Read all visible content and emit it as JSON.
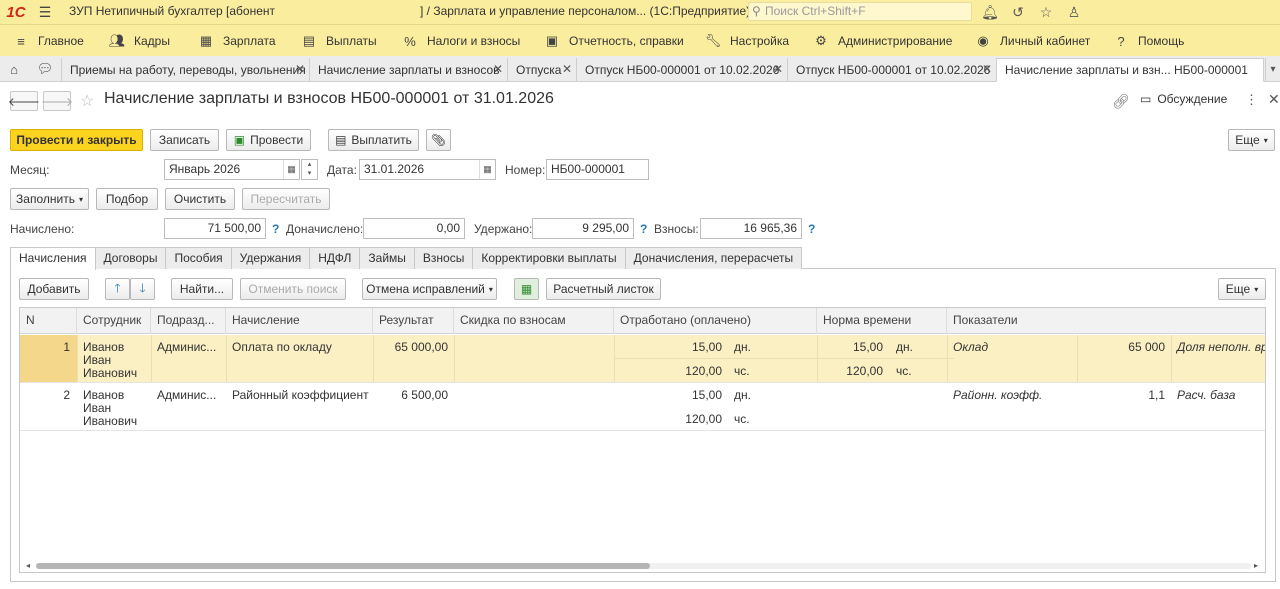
{
  "app": {
    "logo": "1С",
    "title": "ЗУП Нетипичный бухгалтер [абонент",
    "title_suffix": "] / Зарплата и управление персоналом...  (1С:Предприятие)",
    "search_placeholder": "Поиск Ctrl+Shift+F"
  },
  "main_menu": [
    {
      "label": "Главное",
      "icon": "menu-lines-icon"
    },
    {
      "label": "Кадры",
      "icon": "people-icon"
    },
    {
      "label": "Зарплата",
      "icon": "calculator-icon"
    },
    {
      "label": "Выплаты",
      "icon": "wallet-icon"
    },
    {
      "label": "Налоги и взносы",
      "icon": "percent-icon"
    },
    {
      "label": "Отчетность, справки",
      "icon": "report-icon"
    },
    {
      "label": "Настройка",
      "icon": "wrench-icon"
    },
    {
      "label": "Администрирование",
      "icon": "gear-icon"
    },
    {
      "label": "Личный кабинет",
      "icon": "user-icon"
    },
    {
      "label": "Помощь",
      "icon": "question-icon"
    }
  ],
  "open_tabs": [
    {
      "label": "Приемы на работу, переводы, увольнения"
    },
    {
      "label": "Начисление зарплаты и взносов"
    },
    {
      "label": "Отпуска"
    },
    {
      "label": "Отпуск НБ00-000001 от 10.02.2026"
    },
    {
      "label": "Отпуск НБ00-000001 от 10.02.2026"
    },
    {
      "label": "Начисление зарплаты и взн...    НБ00-000001"
    }
  ],
  "document": {
    "title": "Начисление зарплаты и взносов НБ00-000001 от 31.01.2026",
    "discuss_label": "Обсуждение"
  },
  "toolbar": {
    "post_close": "Провести и закрыть",
    "save": "Записать",
    "post": "Провести",
    "pay": "Выплатить",
    "more": "Еще"
  },
  "fields": {
    "month_label": "Месяц:",
    "month_value": "Январь 2026",
    "date_label": "Дата:",
    "date_value": "31.01.2026",
    "number_label": "Номер:",
    "number_value": "НБ00-000001"
  },
  "actions": {
    "fill": "Заполнить",
    "select": "Подбор",
    "clear": "Очистить",
    "recalc": "Пересчитать"
  },
  "totals": {
    "accrued_label": "Начислено:",
    "accrued_value": "71 500,00",
    "extra_label": "Доначислено:",
    "extra_value": "0,00",
    "withheld_label": "Удержано:",
    "withheld_value": "9 295,00",
    "contrib_label": "Взносы:",
    "contrib_value": "16 965,36",
    "help": "?"
  },
  "inner_tabs": [
    "Начисления",
    "Договоры",
    "Пособия",
    "Удержания",
    "НДФЛ",
    "Займы",
    "Взносы",
    "Корректировки выплаты",
    "Доначисления, перерасчеты"
  ],
  "table_toolbar": {
    "add": "Добавить",
    "find": "Найти...",
    "cancel_search": "Отменить поиск",
    "cancel_fix": "Отмена исправлений",
    "payslip": "Расчетный листок",
    "more": "Еще"
  },
  "table": {
    "columns": [
      "N",
      "Сотрудник",
      "Подразд...",
      "Начисление",
      "Результат",
      "Скидка по взносам",
      "Отработано (оплачено)",
      "Норма времени",
      "Показатели"
    ],
    "rows": [
      {
        "n": "1",
        "employee": [
          "Иванов",
          "Иван",
          "Иванович"
        ],
        "dept": "Админис...",
        "accrual": "Оплата по окладу",
        "result": "65 000,00",
        "worked_days": "15,00",
        "days_unit": "дн.",
        "worked_hours": "120,00",
        "hours_unit": "чс.",
        "norm_days": "15,00",
        "norm_days_unit": "дн.",
        "norm_hours": "120,00",
        "norm_hours_unit": "чс.",
        "ind_name": "Оклад",
        "ind_value": "65 000",
        "ind_name2": "Доля неполн. вре"
      },
      {
        "n": "2",
        "employee": [
          "Иванов",
          "Иван",
          "Иванович"
        ],
        "dept": "Админис...",
        "accrual": "Районный коэффициент",
        "result": "6 500,00",
        "worked_days": "15,00",
        "days_unit": "дн.",
        "worked_hours": "120,00",
        "hours_unit": "чс.",
        "ind_name": "Районн. коэфф.",
        "ind_value": "1,1",
        "ind_name2": "Расч. база"
      }
    ]
  }
}
